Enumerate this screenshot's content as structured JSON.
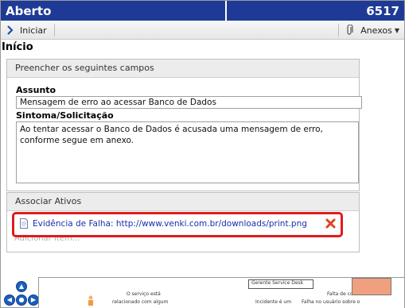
{
  "header": {
    "title": "Aberto",
    "ticket_number": "6517"
  },
  "toolbar": {
    "start_label": "Iniciar",
    "attachments_label": "Anexos"
  },
  "page": {
    "heading": "Início"
  },
  "form_panel": {
    "title": "Preencher os seguintes campos",
    "subject_label": "Assunto",
    "subject_value": "Mensagem de erro ao acessar Banco de Dados",
    "symptom_label": "Sintoma/Solicitação",
    "symptom_value": "Ao tentar acessar o Banco de Dados é acusada uma mensagem de erro, conforme segue em anexo."
  },
  "assets_panel": {
    "title": "Associar Ativos",
    "attachment_link": "Evidência de Falha: http://www.venki.com.br/downloads/print.png",
    "add_item": "Adicionar Item..."
  },
  "bottom_image": {
    "texts": [
      "Gerente Service Desk",
      "O serviço está",
      "relacionado com algum",
      "Falta de conhecimento",
      "Incidente é um",
      "Falha no usuário sobre o"
    ]
  },
  "colors": {
    "header_bg": "#1f3a96",
    "highlight": "#e01b1b",
    "link": "#1a2fa8"
  }
}
